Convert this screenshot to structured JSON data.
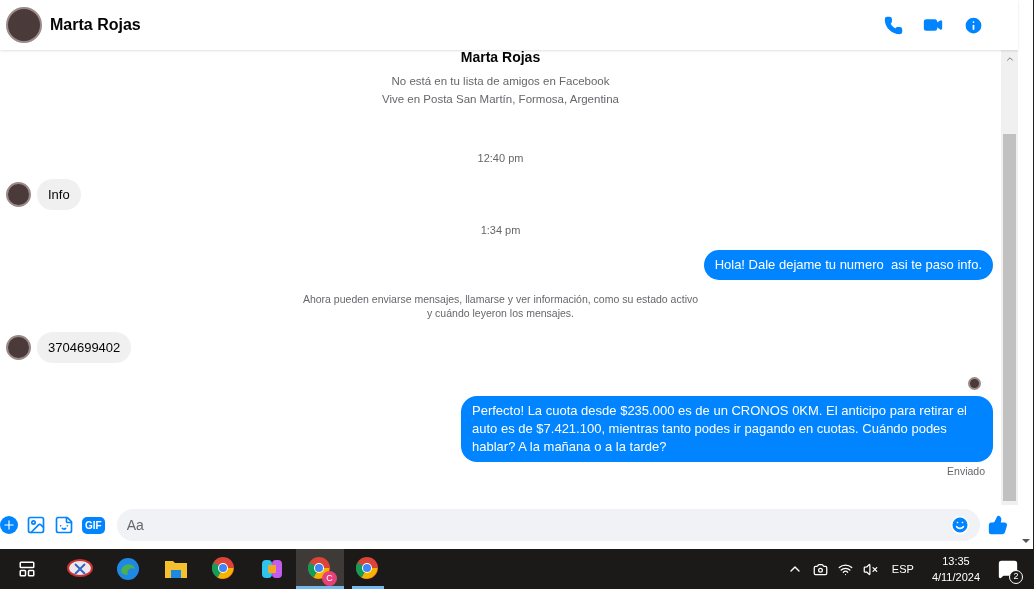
{
  "header": {
    "name": "Marta Rojas"
  },
  "profile": {
    "name": "Marta Rojas",
    "lines": [
      "No está en tu lista de amigos en Facebook",
      "Vive en Posta San Martín, Formosa, Argentina"
    ]
  },
  "messages": [
    {
      "kind": "time",
      "text": "12:40 pm"
    },
    {
      "kind": "incoming",
      "text": "Info"
    },
    {
      "kind": "time",
      "text": "1:34 pm"
    },
    {
      "kind": "outgoing",
      "text": "Hola! Dale dejame tu numero  asi te paso info."
    },
    {
      "kind": "notice",
      "text": "Ahora pueden enviarse mensajes, llamarse y ver información, como su estado activo\ny cuándo leyeron los mensajes."
    },
    {
      "kind": "incoming",
      "text": "3704699402"
    },
    {
      "kind": "seen"
    },
    {
      "kind": "outgoing",
      "text": "Perfecto! La cuota desde $235.000 es de un CRONOS 0KM. El anticipo para retirar el auto es de $7.421.100, mientras tanto podes ir pagando en cuotas. Cuándo podes hablar? A la mañana o a la tarde?"
    },
    {
      "kind": "status",
      "text": "Enviado"
    }
  ],
  "composer": {
    "gif_label": "GIF",
    "placeholder": "Aa"
  },
  "taskbar": {
    "apps": [
      {
        "kind": "snip",
        "selected": false,
        "open": false
      },
      {
        "kind": "edge",
        "selected": false,
        "open": false
      },
      {
        "kind": "folder",
        "selected": false,
        "open": false
      },
      {
        "kind": "chrome",
        "selected": false,
        "open": false
      },
      {
        "kind": "copilot",
        "selected": false,
        "open": false
      },
      {
        "kind": "chrome",
        "selected": true,
        "open": true,
        "badge": "C"
      },
      {
        "kind": "chrome",
        "selected": false,
        "open": true
      }
    ],
    "language": "ESP",
    "time": "13:35",
    "date": "4/11/2024",
    "notifications": "2"
  }
}
